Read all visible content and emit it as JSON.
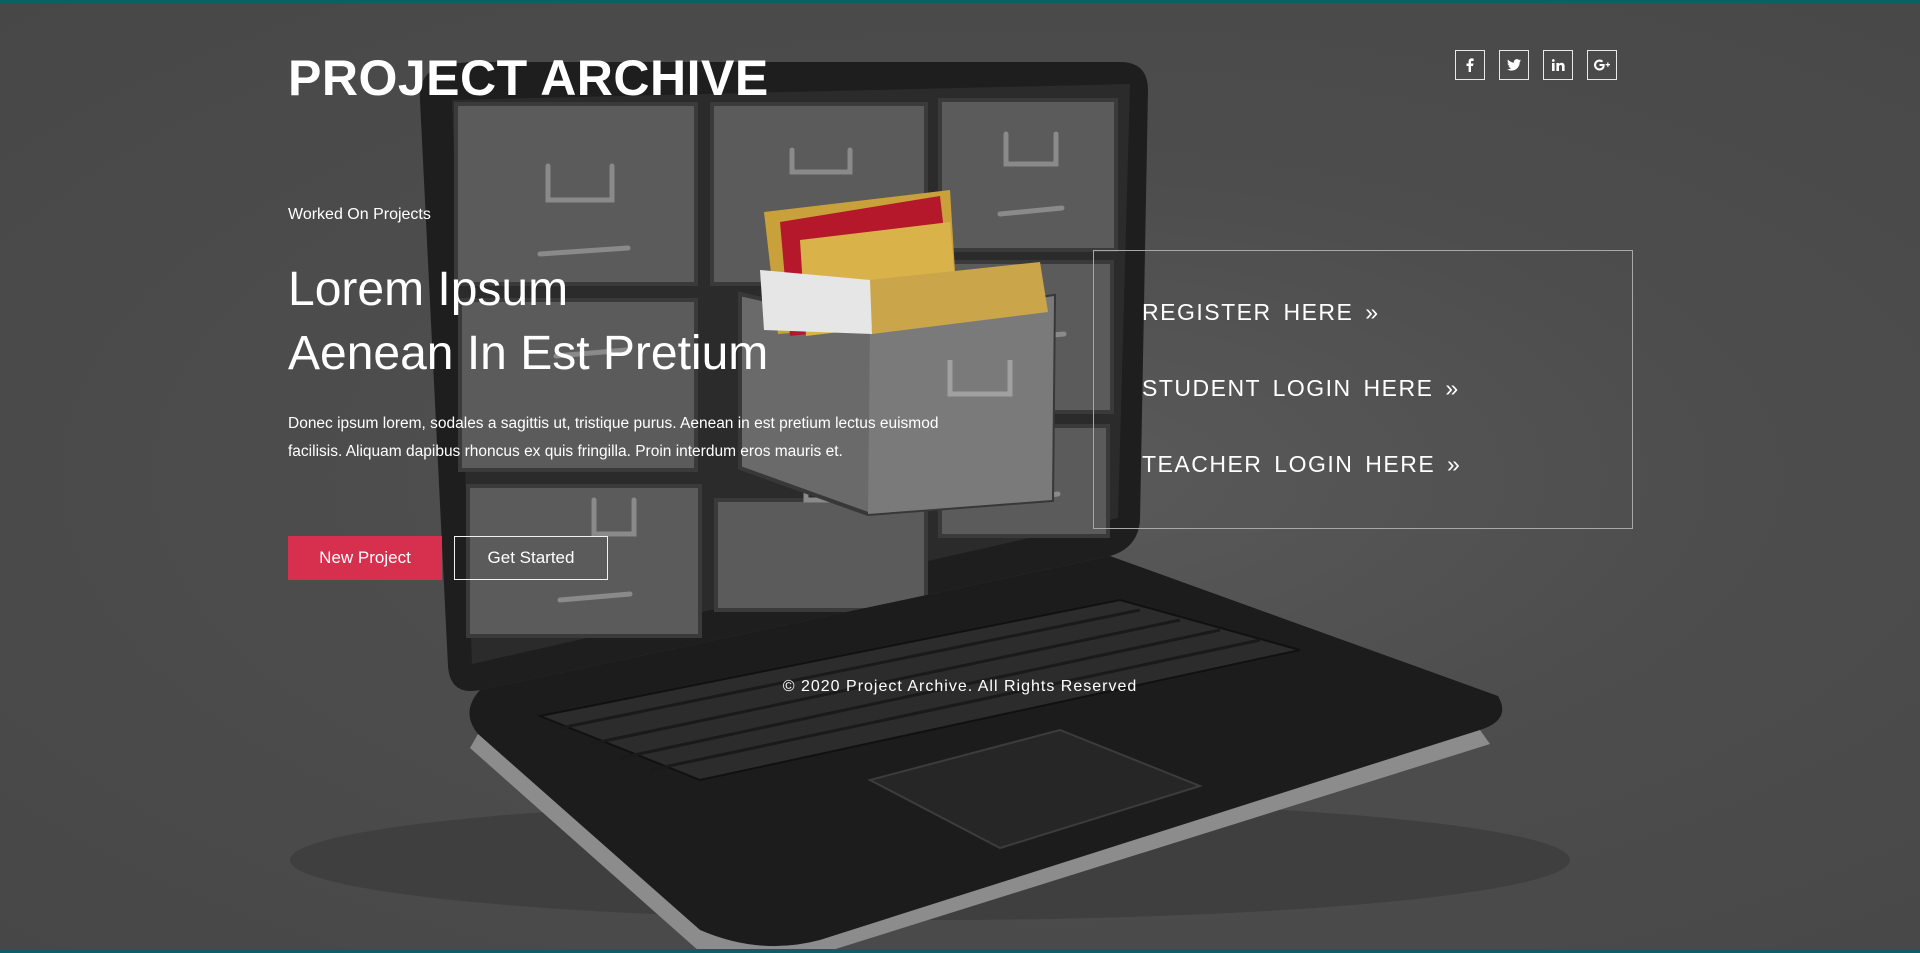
{
  "header": {
    "brand": "PROJECT ARCHIVE",
    "social": [
      {
        "icon": "facebook-icon",
        "glyph": "f"
      },
      {
        "icon": "twitter-icon",
        "glyph": "t"
      },
      {
        "icon": "linkedin-icon",
        "glyph": "in"
      },
      {
        "icon": "google-plus-icon",
        "glyph": "G+"
      }
    ]
  },
  "hero": {
    "eyebrow": "Worked On Projects",
    "title_line1": "Lorem Ipsum",
    "title_line2": "Aenean In Est Pretium",
    "description": "Donec ipsum lorem, sodales a sagittis ut, tristique purus. Aenean in est pretium lectus euismod facilisis. Aliquam dapibus rhoncus ex quis fringilla. Proin interdum eros mauris et.",
    "primary_button": "New Project",
    "secondary_button": "Get Started"
  },
  "login_panel": {
    "register": "REGISTER HERE »",
    "student_login": "STUDENT LOGIN HERE »",
    "teacher_login": "TEACHER LOGIN HERE »"
  },
  "footer": {
    "copyright": "© 2020 Project Archive. All Rights Reserved"
  },
  "colors": {
    "accent": "#d7304f",
    "background": "#4a4a4a",
    "strip": "#0d5f66",
    "text": "#ffffff"
  }
}
